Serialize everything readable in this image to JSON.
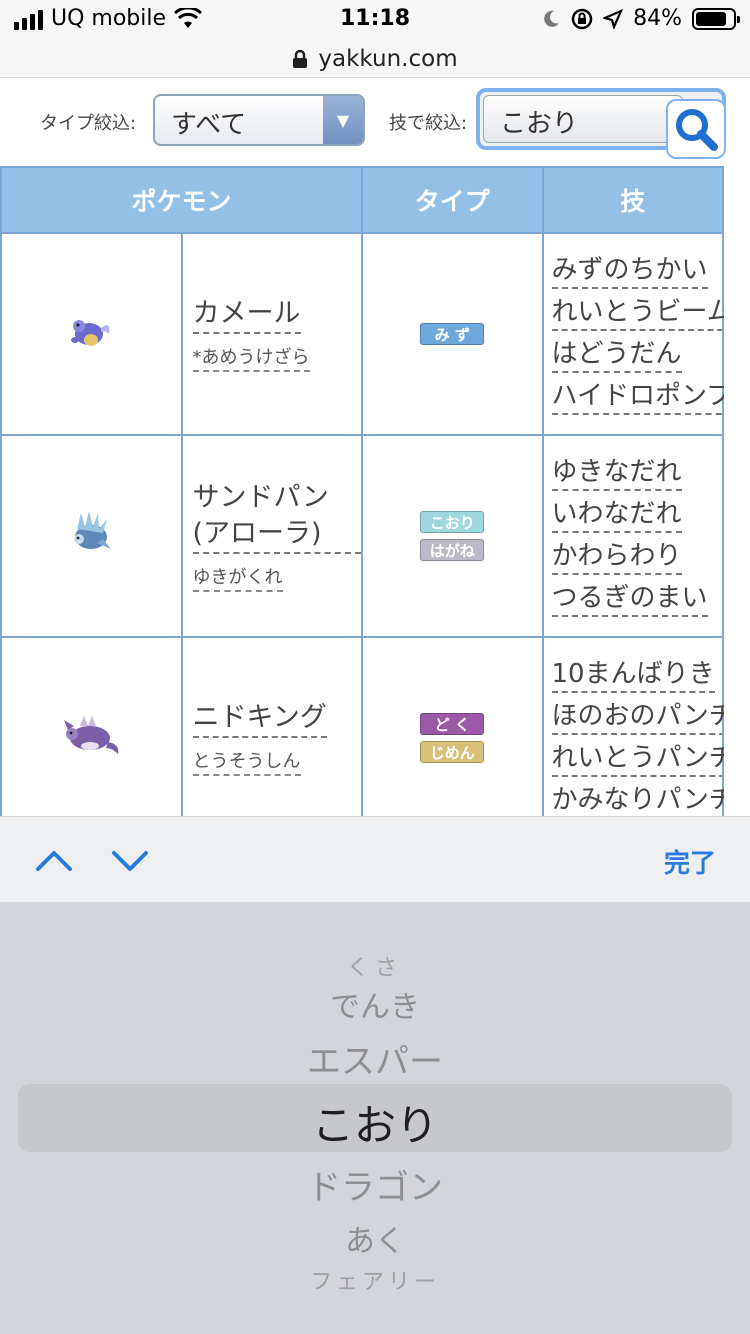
{
  "status_bar": {
    "carrier": "UQ mobile",
    "time": "11:18",
    "battery_percent": "84%",
    "battery_level": 0.84
  },
  "url_bar": {
    "domain": "yakkun.com"
  },
  "filters": {
    "type_label": "タイプ絞込:",
    "type_value": "すべて",
    "move_label": "技で絞込:",
    "move_value": "こおり"
  },
  "table": {
    "headers": {
      "pokemon": "ポケモン",
      "type": "タイプ",
      "moves": "技"
    },
    "rows": [
      {
        "name": "カメール",
        "ability": "*あめうけざら",
        "types": [
          {
            "label": "み ず",
            "color": "#6fa8dc"
          }
        ],
        "moves": [
          "みずのちかい",
          "れいとうビーム",
          "はどうだん",
          "ハイドロポンプ"
        ]
      },
      {
        "name": "サンドパン(アローラ)",
        "ability": "ゆきがくれ",
        "types": [
          {
            "label": "こおり",
            "color": "#9ed8dc"
          },
          {
            "label": "はがね",
            "color": "#b9b9c8"
          }
        ],
        "moves": [
          "ゆきなだれ",
          "いわなだれ",
          "かわらわり",
          "つるぎのまい"
        ]
      },
      {
        "name": "ニドキング",
        "ability": "とうそうしん",
        "types": [
          {
            "label": "ど く",
            "color": "#9b5aa8"
          },
          {
            "label": "じめん",
            "color": "#d8c07a"
          }
        ],
        "moves": [
          "10まんばりき",
          "ほのおのパンチ",
          "れいとうパンチ",
          "かみなりパンチ"
        ]
      }
    ]
  },
  "picker": {
    "done_label": "完了",
    "items": [
      "くさ",
      "でんき",
      "エスパー",
      "こおり",
      "ドラゴン",
      "あく",
      "フェアリー"
    ],
    "selected": "こおり"
  },
  "colors": {
    "header_bg": "#93c0e6",
    "border": "#7ea6d2",
    "accent": "#2a7be0"
  }
}
